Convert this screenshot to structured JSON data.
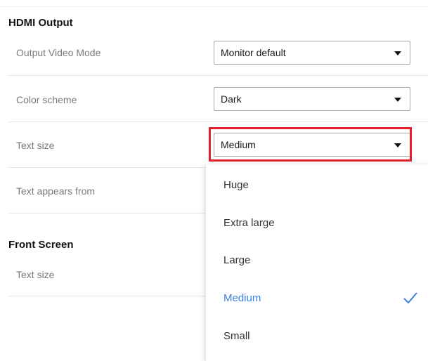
{
  "hdmi": {
    "title": "HDMI Output",
    "rows": [
      {
        "label": "Output Video Mode",
        "value": "Monitor default"
      },
      {
        "label": "Color scheme",
        "value": "Dark"
      },
      {
        "label": "Text size",
        "value": "Medium"
      },
      {
        "label": "Text appears from",
        "value": ""
      }
    ]
  },
  "front": {
    "title": "Front Screen",
    "rows": [
      {
        "label": "Text size"
      }
    ]
  },
  "dropdown": {
    "options": [
      "Huge",
      "Extra large",
      "Large",
      "Medium",
      "Small"
    ],
    "selected": "Medium",
    "check_icon": "check-icon"
  },
  "colors": {
    "highlight": "#e3202b",
    "selected_option": "#3b82e0"
  }
}
